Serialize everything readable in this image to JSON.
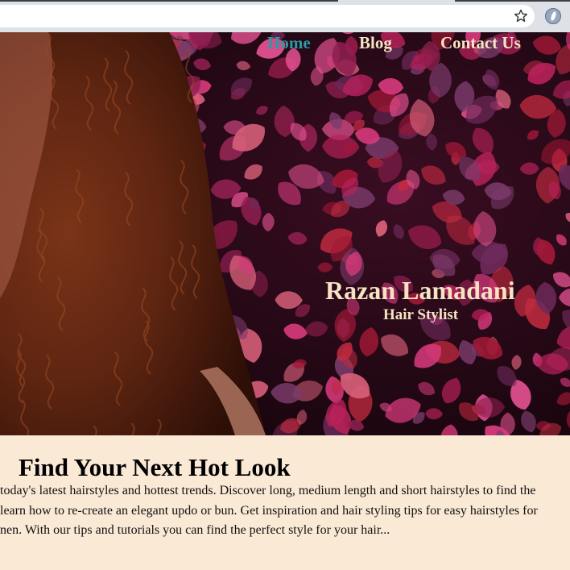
{
  "browser": {
    "star_icon": "star-outline",
    "extension_icon": "extension"
  },
  "nav": {
    "items": [
      {
        "label": "Home",
        "active": true
      },
      {
        "label": "Blog",
        "active": false
      },
      {
        "label": "Contact Us",
        "active": false
      }
    ]
  },
  "hero": {
    "title": "Razan Lamadani",
    "subtitle": "Hair Stylist"
  },
  "content": {
    "heading": "Find Your Next Hot Look",
    "lines": [
      " today's latest hairstyles and hottest trends. Discover long, medium length and short hairstyles to find the",
      " learn how to re-create an elegant updo or bun. Get inspiration and hair styling tips for easy hairstyles for",
      "nen. With our tips and tutorials you can find the perfect style for your hair..."
    ]
  },
  "colors": {
    "nav_active": "#2a9aa4",
    "nav_text": "#f6e3c3",
    "hero_text": "#f6e3c3",
    "content_bg": "#fae9d5"
  }
}
